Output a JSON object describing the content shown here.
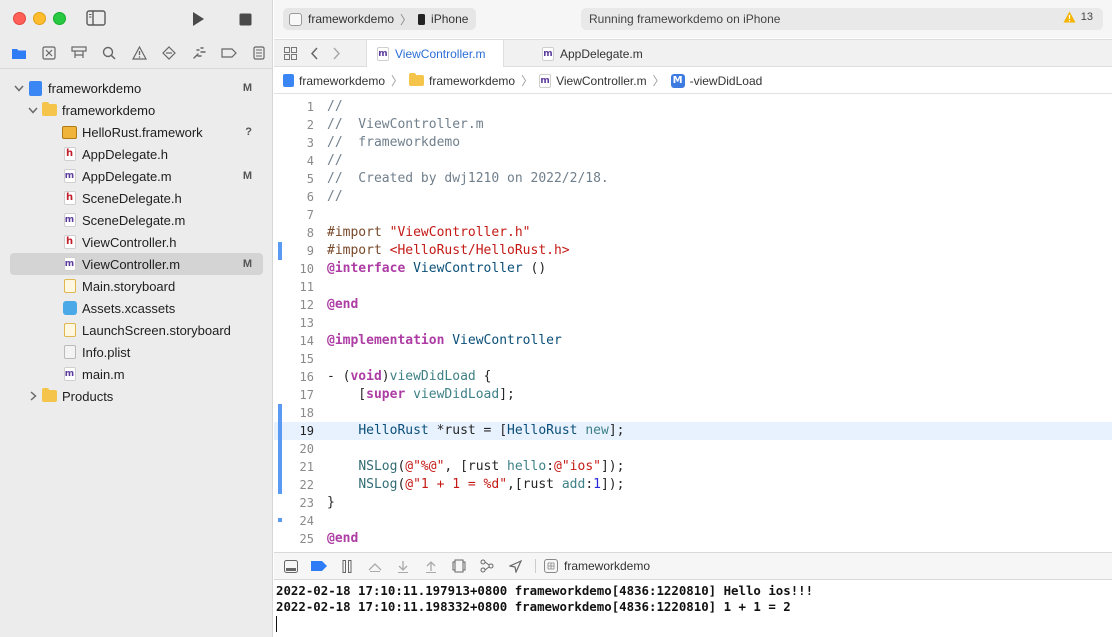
{
  "toolbar": {
    "scheme_project": "frameworkdemo",
    "scheme_device": "iPhone",
    "status_text": "Running frameworkdemo on iPhone",
    "warning_count": "13"
  },
  "navigator": {
    "icons": [
      "folder-icon",
      "x-square-icon",
      "hierarchy-icon",
      "search-icon",
      "warning-icon",
      "diamond-icon",
      "breakpoint-icon",
      "tag-icon",
      "report-icon"
    ],
    "items": [
      {
        "label": "frameworkdemo",
        "badge": "M",
        "icon": "project-icon",
        "indent": 0,
        "disclosure": "open"
      },
      {
        "label": "frameworkdemo",
        "badge": "",
        "icon": "folder-icon",
        "indent": 1,
        "disclosure": "open"
      },
      {
        "label": "HelloRust.framework",
        "badge": "?",
        "icon": "framework-icon",
        "indent": 2,
        "disclosure": ""
      },
      {
        "label": "AppDelegate.h",
        "badge": "",
        "icon": "h-file-icon",
        "indent": 2,
        "disclosure": ""
      },
      {
        "label": "AppDelegate.m",
        "badge": "M",
        "icon": "m-file-icon",
        "indent": 2,
        "disclosure": ""
      },
      {
        "label": "SceneDelegate.h",
        "badge": "",
        "icon": "h-file-icon",
        "indent": 2,
        "disclosure": ""
      },
      {
        "label": "SceneDelegate.m",
        "badge": "",
        "icon": "m-file-icon",
        "indent": 2,
        "disclosure": ""
      },
      {
        "label": "ViewController.h",
        "badge": "",
        "icon": "h-file-icon",
        "indent": 2,
        "disclosure": ""
      },
      {
        "label": "ViewController.m",
        "badge": "M",
        "icon": "m-file-icon",
        "indent": 2,
        "disclosure": "",
        "selected": true
      },
      {
        "label": "Main.storyboard",
        "badge": "",
        "icon": "storyboard-icon",
        "indent": 2,
        "disclosure": ""
      },
      {
        "label": "Assets.xcassets",
        "badge": "",
        "icon": "assets-icon",
        "indent": 2,
        "disclosure": ""
      },
      {
        "label": "LaunchScreen.storyboard",
        "badge": "",
        "icon": "storyboard-icon",
        "indent": 2,
        "disclosure": ""
      },
      {
        "label": "Info.plist",
        "badge": "",
        "icon": "plist-icon",
        "indent": 2,
        "disclosure": ""
      },
      {
        "label": "main.m",
        "badge": "",
        "icon": "m-file-icon",
        "indent": 2,
        "disclosure": ""
      },
      {
        "label": "Products",
        "badge": "",
        "icon": "folder-icon",
        "indent": 1,
        "disclosure": "closed"
      }
    ]
  },
  "tabs": [
    {
      "label": "ViewController.m",
      "active": true
    },
    {
      "label": "AppDelegate.m",
      "active": false
    }
  ],
  "jumpbar": {
    "project": "frameworkdemo",
    "group": "frameworkdemo",
    "file": "ViewController.m",
    "symbol": "-viewDidLoad"
  },
  "editor": {
    "current_line": 19,
    "lines": [
      "//",
      "//  ViewController.m",
      "//  frameworkdemo",
      "//",
      "//  Created by dwj1210 on 2022/2/18.",
      "//",
      "",
      "#import \"ViewController.h\"",
      "#import <HelloRust/HelloRust.h>",
      "@interface ViewController ()",
      "",
      "@end",
      "",
      "@implementation ViewController",
      "",
      "- (void)viewDidLoad {",
      "    [super viewDidLoad];",
      "",
      "    HelloRust *rust = [HelloRust new];",
      "",
      "    NSLog(@\"%@\", [rust hello:@\"ios\"]);",
      "    NSLog(@\"1 + 1 = %d\",[rust add:1]);",
      "}",
      "",
      "@end"
    ]
  },
  "debug": {
    "target": "frameworkdemo"
  },
  "console": {
    "lines": [
      "2022-02-18 17:10:11.197913+0800 frameworkdemo[4836:1220810] Hello ios!!!",
      "2022-02-18 17:10:11.198332+0800 frameworkdemo[4836:1220810] 1 + 1 = 2"
    ]
  },
  "colors": {
    "accent": "#2b6dd6",
    "change_bar": "#5a9af2",
    "current_line": "#e8f2fe"
  }
}
